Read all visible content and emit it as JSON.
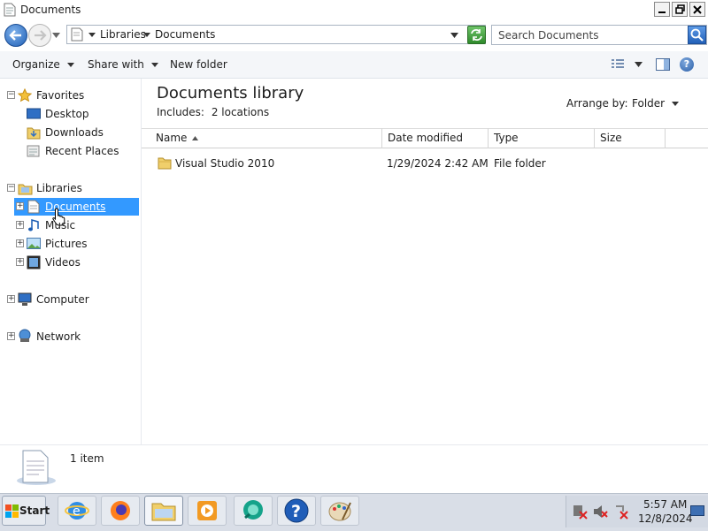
{
  "window": {
    "title": "Documents"
  },
  "nav": {
    "breadcrumb": [
      "Libraries",
      "Documents"
    ],
    "search_placeholder": "Search Documents"
  },
  "toolbar": {
    "organize": "Organize",
    "share_with": "Share with",
    "new_folder": "New folder"
  },
  "sidebar": {
    "favorites": {
      "label": "Favorites",
      "items": [
        "Desktop",
        "Downloads",
        "Recent Places"
      ]
    },
    "libraries": {
      "label": "Libraries",
      "items": [
        "Documents",
        "Music",
        "Pictures",
        "Videos"
      ]
    },
    "computer": "Computer",
    "network": "Network"
  },
  "library": {
    "title": "Documents library",
    "includes_label": "Includes:",
    "includes_value": "2 locations",
    "arrange_label": "Arrange by:",
    "arrange_value": "Folder"
  },
  "columns": [
    "Name",
    "Date modified",
    "Type",
    "Size"
  ],
  "files": [
    {
      "name": "Visual Studio 2010",
      "date": "1/29/2024 2:42 AM",
      "type": "File folder",
      "size": ""
    }
  ],
  "details": {
    "count": "1 item"
  },
  "taskbar": {
    "start_label": "Start",
    "apps": [
      "internet-explorer",
      "firefox",
      "file-explorer",
      "media-player",
      "messenger",
      "help",
      "paint"
    ],
    "time": "5:57 AM",
    "date": "12/8/2024"
  },
  "colors": {
    "selection": "#3399ff",
    "accent": "#1e6fd0"
  }
}
